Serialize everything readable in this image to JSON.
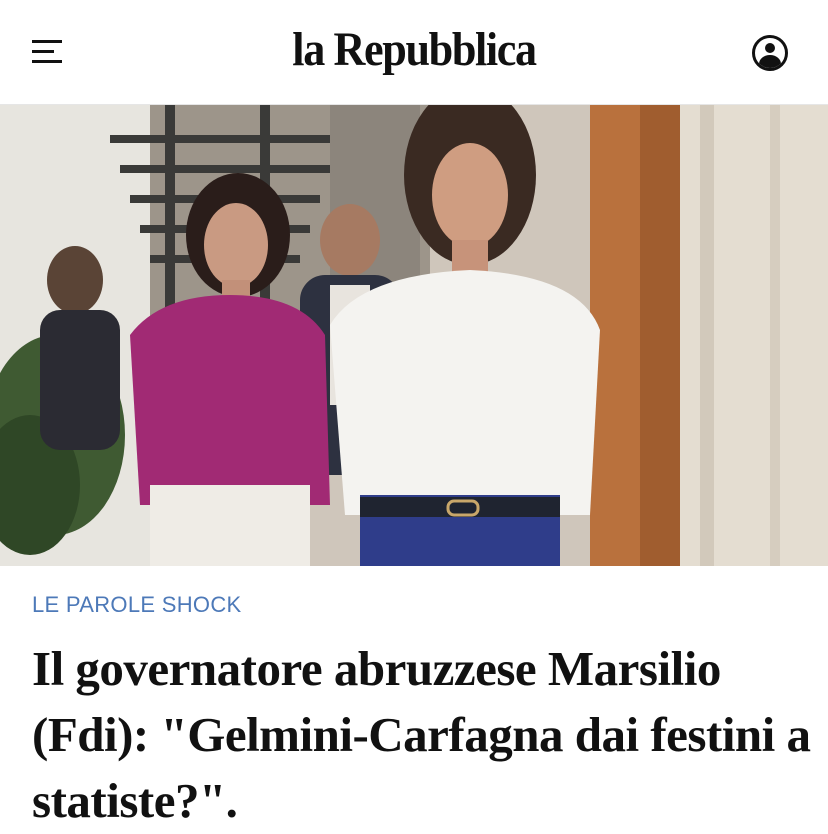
{
  "header": {
    "logo": "la Repubblica",
    "menu_icon": "hamburger-menu-icon",
    "user_icon": "user-account-icon"
  },
  "article": {
    "kicker": "LE PAROLE SHOCK",
    "headline": "Il governatore abruzzese Marsilio (Fdi): \"Gelmini-Carfagna dai festini a statiste?\".",
    "kicker_color": "#4d79b8"
  }
}
